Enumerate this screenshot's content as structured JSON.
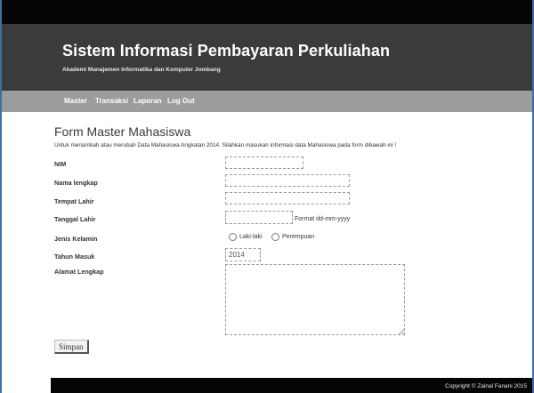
{
  "header": {
    "title": "Sistem Informasi Pembayaran Perkuliahan",
    "subtitle": "Akademi Manajemen Informatika dan Komputer Jombang"
  },
  "nav": {
    "items": [
      {
        "label": "Master"
      },
      {
        "label": "Transaksi"
      },
      {
        "label": "Laporan"
      },
      {
        "label": "Log Out"
      }
    ]
  },
  "form": {
    "heading": "Form Master Mahasiswa",
    "intro": "Untuk menambah atau merubah Data Mahasiswa Angkatan 2014. Silahkan masukan informasi data Mahasiswa pada form dibawah ini !",
    "fields": {
      "nim": {
        "label": "NIM",
        "value": ""
      },
      "nama": {
        "label": "Nama lengkap",
        "value": ""
      },
      "tempat_lahir": {
        "label": "Tempat Lahir",
        "value": ""
      },
      "tanggal_lahir": {
        "label": "Tanggal Lahir",
        "value": "",
        "hint": "Format dd-mm-yyyy"
      },
      "jenis_kelamin": {
        "label": "Jenis Kelamin",
        "options": [
          "Laki-laki",
          "Perempuan"
        ]
      },
      "tahun_masuk": {
        "label": "Tahun Masuk",
        "value": "2014"
      },
      "alamat": {
        "label": "Alamat Lengkap",
        "value": ""
      }
    },
    "submit_label": "Simpan"
  },
  "footer": {
    "copyright": "Copyright © Zainal Fanani 2015"
  }
}
